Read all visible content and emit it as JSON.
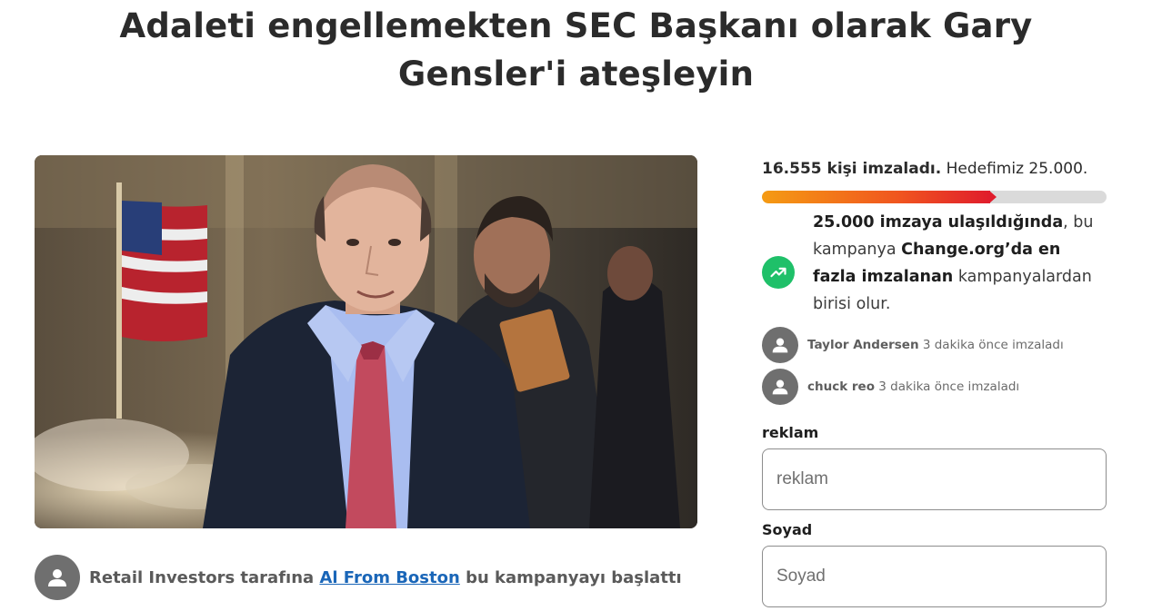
{
  "petition": {
    "title": "Adaleti engellemekten SEC Başkanı olarak Gary Gensler'i ateşleyin",
    "starter": {
      "before": "Retail Investors tarafına ",
      "author": "Al From Boston",
      "after": " bu kampanyayı başlattı"
    }
  },
  "signatures": {
    "count_text": "16.555 kişi imzaladı.",
    "goal_text": " Hedefimiz 25.000.",
    "signed": 16555,
    "goal": 25000
  },
  "milestone": {
    "bold1": "25.000 imzaya ulaşıldığında",
    "text1": ", bu kampanya ",
    "bold2": "Change.org’da en fazla imzalanan",
    "text2": " kampanyalardan birisi olur."
  },
  "recent_signers": [
    {
      "name": "Taylor Andersen",
      "time": " 3 dakika önce imzaladı"
    },
    {
      "name": "chuck reo",
      "time": " 3 dakika önce imzaladı"
    }
  ],
  "form": {
    "first_name": {
      "label": "reklam",
      "placeholder": "reklam"
    },
    "last_name": {
      "label": "Soyad",
      "placeholder": "Soyad"
    }
  },
  "colors": {
    "progress_start": "#f59b13",
    "progress_end": "#e01d2c",
    "milestone_icon": "#1fc069",
    "link": "#1a66b8"
  },
  "icons": {
    "milestone": "trending-up-icon",
    "avatar": "user-icon"
  }
}
